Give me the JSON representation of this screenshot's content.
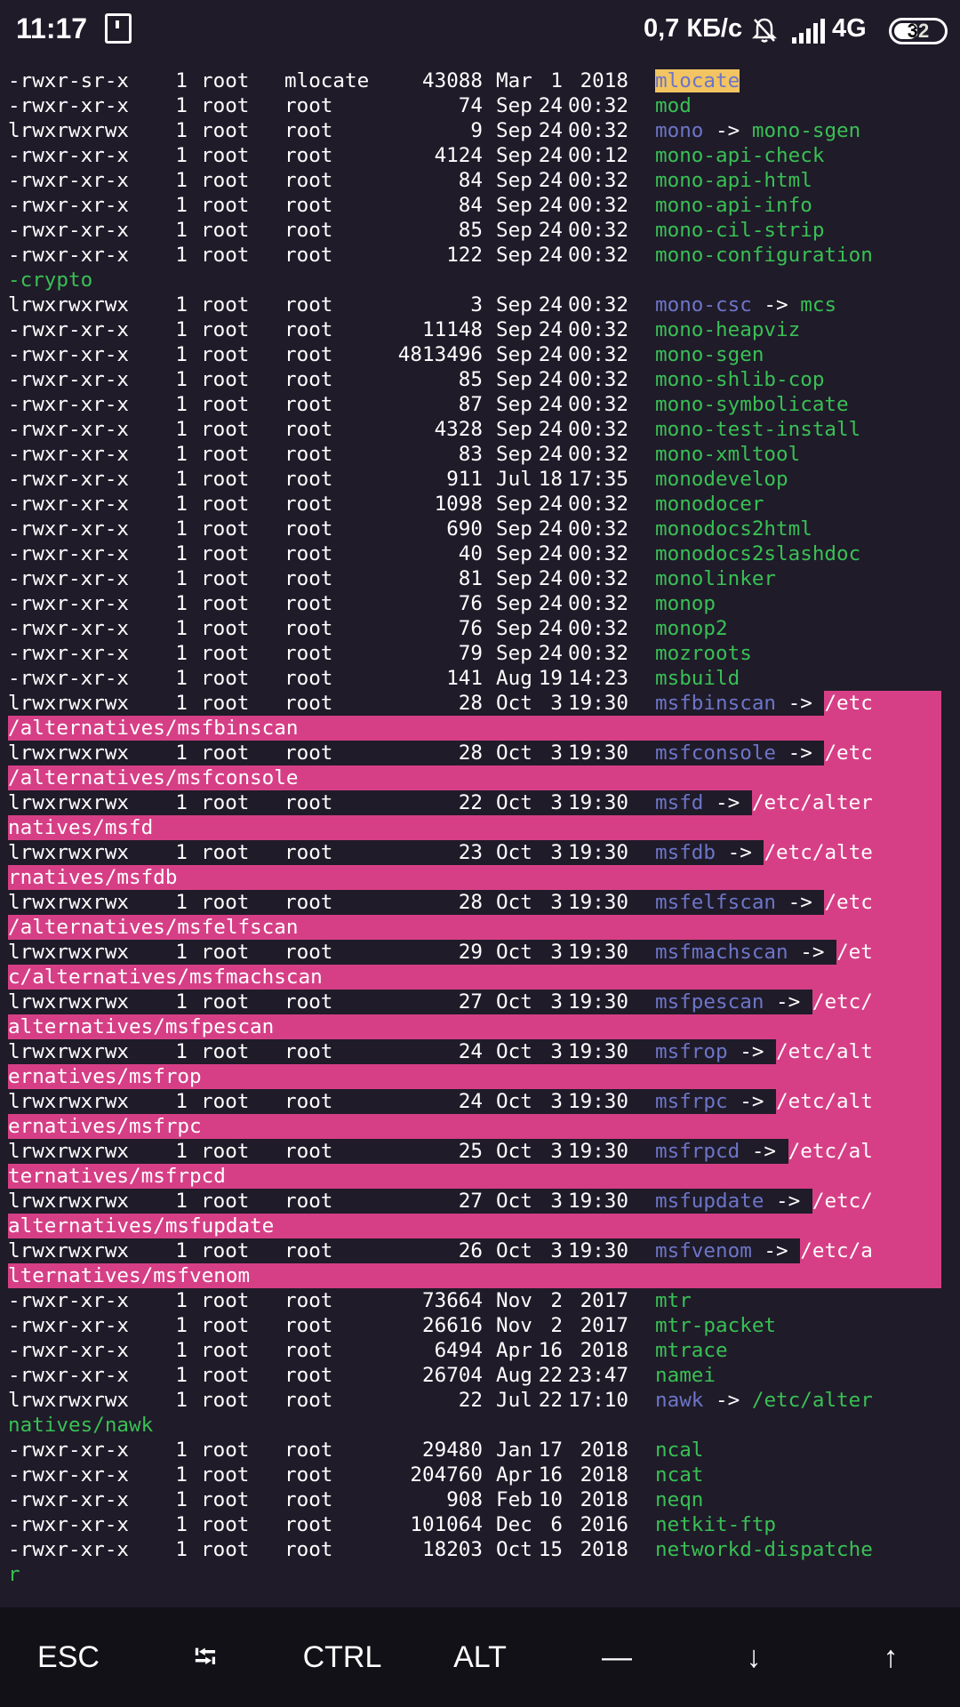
{
  "status_bar": {
    "time": "11:17",
    "net_speed": "0,7 КБ/с",
    "network": "4G",
    "battery": "32"
  },
  "listing": [
    {
      "perm": "-rwxr-sr-x",
      "links": "1",
      "owner": "root",
      "group": "mlocate",
      "size": "43088",
      "month": "Mar",
      "day": "1",
      "time": "2018",
      "name": "mlocate",
      "style": "yellow"
    },
    {
      "perm": "-rwxr-xr-x",
      "links": "1",
      "owner": "root",
      "group": "root",
      "size": "74",
      "month": "Sep",
      "day": "24",
      "time": "00:32",
      "name": "mod",
      "style": "exec"
    },
    {
      "perm": "lrwxrwxrwx",
      "links": "1",
      "owner": "root",
      "group": "root",
      "size": "9",
      "month": "Sep",
      "day": "24",
      "time": "00:32",
      "name": "mono",
      "style": "link",
      "target": "mono-sgen",
      "target_style": "green"
    },
    {
      "perm": "-rwxr-xr-x",
      "links": "1",
      "owner": "root",
      "group": "root",
      "size": "4124",
      "month": "Sep",
      "day": "24",
      "time": "00:12",
      "name": "mono-api-check",
      "style": "exec"
    },
    {
      "perm": "-rwxr-xr-x",
      "links": "1",
      "owner": "root",
      "group": "root",
      "size": "84",
      "month": "Sep",
      "day": "24",
      "time": "00:32",
      "name": "mono-api-html",
      "style": "exec"
    },
    {
      "perm": "-rwxr-xr-x",
      "links": "1",
      "owner": "root",
      "group": "root",
      "size": "84",
      "month": "Sep",
      "day": "24",
      "time": "00:32",
      "name": "mono-api-info",
      "style": "exec"
    },
    {
      "perm": "-rwxr-xr-x",
      "links": "1",
      "owner": "root",
      "group": "root",
      "size": "85",
      "month": "Sep",
      "day": "24",
      "time": "00:32",
      "name": "mono-cil-strip",
      "style": "exec"
    },
    {
      "perm": "-rwxr-xr-x",
      "links": "1",
      "owner": "root",
      "group": "root",
      "size": "122",
      "month": "Sep",
      "day": "24",
      "time": "00:32",
      "name": "mono-configuration",
      "style": "exec",
      "cont": "-crypto",
      "cont_style": "green"
    },
    {
      "perm": "lrwxrwxrwx",
      "links": "1",
      "owner": "root",
      "group": "root",
      "size": "3",
      "month": "Sep",
      "day": "24",
      "time": "00:32",
      "name": "mono-csc",
      "style": "link",
      "target": "mcs",
      "target_style": "green"
    },
    {
      "perm": "-rwxr-xr-x",
      "links": "1",
      "owner": "root",
      "group": "root",
      "size": "11148",
      "month": "Sep",
      "day": "24",
      "time": "00:32",
      "name": "mono-heapviz",
      "style": "exec"
    },
    {
      "perm": "-rwxr-xr-x",
      "links": "1",
      "owner": "root",
      "group": "root",
      "size": "4813496",
      "month": "Sep",
      "day": "24",
      "time": "00:32",
      "name": "mono-sgen",
      "style": "exec"
    },
    {
      "perm": "-rwxr-xr-x",
      "links": "1",
      "owner": "root",
      "group": "root",
      "size": "85",
      "month": "Sep",
      "day": "24",
      "time": "00:32",
      "name": "mono-shlib-cop",
      "style": "exec"
    },
    {
      "perm": "-rwxr-xr-x",
      "links": "1",
      "owner": "root",
      "group": "root",
      "size": "87",
      "month": "Sep",
      "day": "24",
      "time": "00:32",
      "name": "mono-symbolicate",
      "style": "exec"
    },
    {
      "perm": "-rwxr-xr-x",
      "links": "1",
      "owner": "root",
      "group": "root",
      "size": "4328",
      "month": "Sep",
      "day": "24",
      "time": "00:32",
      "name": "mono-test-install",
      "style": "exec"
    },
    {
      "perm": "-rwxr-xr-x",
      "links": "1",
      "owner": "root",
      "group": "root",
      "size": "83",
      "month": "Sep",
      "day": "24",
      "time": "00:32",
      "name": "mono-xmltool",
      "style": "exec"
    },
    {
      "perm": "-rwxr-xr-x",
      "links": "1",
      "owner": "root",
      "group": "root",
      "size": "911",
      "month": "Jul",
      "day": "18",
      "time": "17:35",
      "name": "monodevelop",
      "style": "exec"
    },
    {
      "perm": "-rwxr-xr-x",
      "links": "1",
      "owner": "root",
      "group": "root",
      "size": "1098",
      "month": "Sep",
      "day": "24",
      "time": "00:32",
      "name": "monodocer",
      "style": "exec"
    },
    {
      "perm": "-rwxr-xr-x",
      "links": "1",
      "owner": "root",
      "group": "root",
      "size": "690",
      "month": "Sep",
      "day": "24",
      "time": "00:32",
      "name": "monodocs2html",
      "style": "exec"
    },
    {
      "perm": "-rwxr-xr-x",
      "links": "1",
      "owner": "root",
      "group": "root",
      "size": "40",
      "month": "Sep",
      "day": "24",
      "time": "00:32",
      "name": "monodocs2slashdoc",
      "style": "exec"
    },
    {
      "perm": "-rwxr-xr-x",
      "links": "1",
      "owner": "root",
      "group": "root",
      "size": "81",
      "month": "Sep",
      "day": "24",
      "time": "00:32",
      "name": "monolinker",
      "style": "exec"
    },
    {
      "perm": "-rwxr-xr-x",
      "links": "1",
      "owner": "root",
      "group": "root",
      "size": "76",
      "month": "Sep",
      "day": "24",
      "time": "00:32",
      "name": "monop",
      "style": "exec"
    },
    {
      "perm": "-rwxr-xr-x",
      "links": "1",
      "owner": "root",
      "group": "root",
      "size": "76",
      "month": "Sep",
      "day": "24",
      "time": "00:32",
      "name": "monop2",
      "style": "exec"
    },
    {
      "perm": "-rwxr-xr-x",
      "links": "1",
      "owner": "root",
      "group": "root",
      "size": "79",
      "month": "Sep",
      "day": "24",
      "time": "00:32",
      "name": "mozroots",
      "style": "exec"
    },
    {
      "perm": "-rwxr-xr-x",
      "links": "1",
      "owner": "root",
      "group": "root",
      "size": "141",
      "month": "Aug",
      "day": "19",
      "time": "14:23",
      "name": "msbuild",
      "style": "exec"
    },
    {
      "perm": "lrwxrwxrwx",
      "links": "1",
      "owner": "root",
      "group": "root",
      "size": "28",
      "month": "Oct",
      "day": "3",
      "time": "19:30",
      "name": "msfbinscan",
      "style": "link",
      "target": "/etc",
      "target_style": "pink",
      "cont": "/alternatives/msfbinscan",
      "cont_style": "pink"
    },
    {
      "perm": "lrwxrwxrwx",
      "links": "1",
      "owner": "root",
      "group": "root",
      "size": "28",
      "month": "Oct",
      "day": "3",
      "time": "19:30",
      "name": "msfconsole",
      "style": "link",
      "target": "/etc",
      "target_style": "pink",
      "cont": "/alternatives/msfconsole",
      "cont_style": "pink"
    },
    {
      "perm": "lrwxrwxrwx",
      "links": "1",
      "owner": "root",
      "group": "root",
      "size": "22",
      "month": "Oct",
      "day": "3",
      "time": "19:30",
      "name": "msfd",
      "style": "link",
      "target": "/etc/alter",
      "target_style": "pink",
      "cont": "natives/msfd",
      "cont_style": "pink"
    },
    {
      "perm": "lrwxrwxrwx",
      "links": "1",
      "owner": "root",
      "group": "root",
      "size": "23",
      "month": "Oct",
      "day": "3",
      "time": "19:30",
      "name": "msfdb",
      "style": "link",
      "target": "/etc/alte",
      "target_style": "pink",
      "cont": "rnatives/msfdb",
      "cont_style": "pink"
    },
    {
      "perm": "lrwxrwxrwx",
      "links": "1",
      "owner": "root",
      "group": "root",
      "size": "28",
      "month": "Oct",
      "day": "3",
      "time": "19:30",
      "name": "msfelfscan",
      "style": "link",
      "target": "/etc",
      "target_style": "pink",
      "cont": "/alternatives/msfelfscan",
      "cont_style": "pink"
    },
    {
      "perm": "lrwxrwxrwx",
      "links": "1",
      "owner": "root",
      "group": "root",
      "size": "29",
      "month": "Oct",
      "day": "3",
      "time": "19:30",
      "name": "msfmachscan",
      "style": "link",
      "target": "/et",
      "target_style": "pink",
      "cont": "c/alternatives/msfmachscan",
      "cont_style": "pink"
    },
    {
      "perm": "lrwxrwxrwx",
      "links": "1",
      "owner": "root",
      "group": "root",
      "size": "27",
      "month": "Oct",
      "day": "3",
      "time": "19:30",
      "name": "msfpescan",
      "style": "link",
      "target": "/etc/",
      "target_style": "pink",
      "cont": "alternatives/msfpescan",
      "cont_style": "pink"
    },
    {
      "perm": "lrwxrwxrwx",
      "links": "1",
      "owner": "root",
      "group": "root",
      "size": "24",
      "month": "Oct",
      "day": "3",
      "time": "19:30",
      "name": "msfrop",
      "style": "link",
      "target": "/etc/alt",
      "target_style": "pink",
      "cont": "ernatives/msfrop",
      "cont_style": "pink"
    },
    {
      "perm": "lrwxrwxrwx",
      "links": "1",
      "owner": "root",
      "group": "root",
      "size": "24",
      "month": "Oct",
      "day": "3",
      "time": "19:30",
      "name": "msfrpc",
      "style": "link",
      "target": "/etc/alt",
      "target_style": "pink",
      "cont": "ernatives/msfrpc",
      "cont_style": "pink"
    },
    {
      "perm": "lrwxrwxrwx",
      "links": "1",
      "owner": "root",
      "group": "root",
      "size": "25",
      "month": "Oct",
      "day": "3",
      "time": "19:30",
      "name": "msfrpcd",
      "style": "link",
      "target": "/etc/al",
      "target_style": "pink",
      "cont": "ternatives/msfrpcd",
      "cont_style": "pink"
    },
    {
      "perm": "lrwxrwxrwx",
      "links": "1",
      "owner": "root",
      "group": "root",
      "size": "27",
      "month": "Oct",
      "day": "3",
      "time": "19:30",
      "name": "msfupdate",
      "style": "link",
      "target": "/etc/",
      "target_style": "pink",
      "cont": "alternatives/msfupdate",
      "cont_style": "pink"
    },
    {
      "perm": "lrwxrwxrwx",
      "links": "1",
      "owner": "root",
      "group": "root",
      "size": "26",
      "month": "Oct",
      "day": "3",
      "time": "19:30",
      "name": "msfvenom",
      "style": "link",
      "target": "/etc/a",
      "target_style": "pink",
      "cont": "lternatives/msfvenom",
      "cont_style": "pink"
    },
    {
      "perm": "-rwxr-xr-x",
      "links": "1",
      "owner": "root",
      "group": "root",
      "size": "73664",
      "month": "Nov",
      "day": "2",
      "time": "2017",
      "name": "mtr",
      "style": "exec"
    },
    {
      "perm": "-rwxr-xr-x",
      "links": "1",
      "owner": "root",
      "group": "root",
      "size": "26616",
      "month": "Nov",
      "day": "2",
      "time": "2017",
      "name": "mtr-packet",
      "style": "exec"
    },
    {
      "perm": "-rwxr-xr-x",
      "links": "1",
      "owner": "root",
      "group": "root",
      "size": "6494",
      "month": "Apr",
      "day": "16",
      "time": "2018",
      "name": "mtrace",
      "style": "exec"
    },
    {
      "perm": "-rwxr-xr-x",
      "links": "1",
      "owner": "root",
      "group": "root",
      "size": "26704",
      "month": "Aug",
      "day": "22",
      "time": "23:47",
      "name": "namei",
      "style": "exec"
    },
    {
      "perm": "lrwxrwxrwx",
      "links": "1",
      "owner": "root",
      "group": "root",
      "size": "22",
      "month": "Jul",
      "day": "22",
      "time": "17:10",
      "name": "nawk",
      "style": "link",
      "target": "/etc/alter",
      "target_style": "green",
      "cont": "natives/nawk",
      "cont_style": "green"
    },
    {
      "perm": "-rwxr-xr-x",
      "links": "1",
      "owner": "root",
      "group": "root",
      "size": "29480",
      "month": "Jan",
      "day": "17",
      "time": "2018",
      "name": "ncal",
      "style": "exec"
    },
    {
      "perm": "-rwxr-xr-x",
      "links": "1",
      "owner": "root",
      "group": "root",
      "size": "204760",
      "month": "Apr",
      "day": "16",
      "time": "2018",
      "name": "ncat",
      "style": "exec"
    },
    {
      "perm": "-rwxr-xr-x",
      "links": "1",
      "owner": "root",
      "group": "root",
      "size": "908",
      "month": "Feb",
      "day": "10",
      "time": "2018",
      "name": "neqn",
      "style": "exec"
    },
    {
      "perm": "-rwxr-xr-x",
      "links": "1",
      "owner": "root",
      "group": "root",
      "size": "101064",
      "month": "Dec",
      "day": "6",
      "time": "2016",
      "name": "netkit-ftp",
      "style": "exec"
    },
    {
      "perm": "-rwxr-xr-x",
      "links": "1",
      "owner": "root",
      "group": "root",
      "size": "18203",
      "month": "Oct",
      "day": "15",
      "time": "2018",
      "name": "networkd-dispatche",
      "style": "exec",
      "cont": "r",
      "cont_style": "green"
    }
  ],
  "extra_keys": [
    {
      "label": "ESC",
      "icon": "esc-key"
    },
    {
      "label": "⭾",
      "icon": "tab-key"
    },
    {
      "label": "CTRL",
      "icon": "ctrl-key"
    },
    {
      "label": "ALT",
      "icon": "alt-key"
    },
    {
      "label": "—",
      "icon": "dash-key"
    },
    {
      "label": "↓",
      "icon": "arrow-down-key"
    },
    {
      "label": "↑",
      "icon": "arrow-up-key"
    }
  ]
}
